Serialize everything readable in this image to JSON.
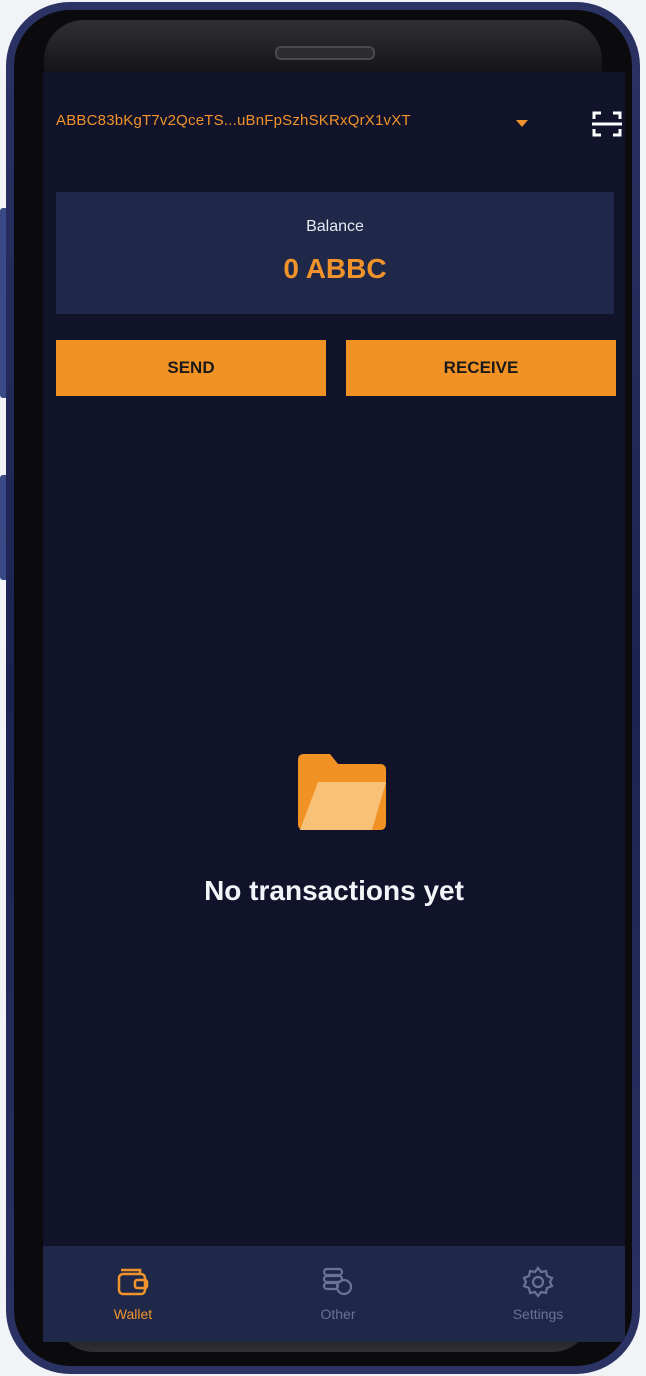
{
  "header": {
    "address": "ABBC83bKgT7v2QceTS...uBnFpSzhSKRxQrX1vXT",
    "dropdown_icon": "caret-down-icon",
    "scan_icon": "scan-icon"
  },
  "balance": {
    "label": "Balance",
    "value": "0 ABBC"
  },
  "actions": {
    "send_label": "SEND",
    "receive_label": "RECEIVE"
  },
  "empty_state": {
    "icon": "folder-icon",
    "message": "No transactions yet"
  },
  "tabs": [
    {
      "label": "Wallet",
      "icon": "wallet-icon",
      "active": true
    },
    {
      "label": "Other",
      "icon": "coins-icon",
      "active": false
    },
    {
      "label": "Settings",
      "icon": "gear-icon",
      "active": false
    }
  ],
  "colors": {
    "accent": "#f0932a",
    "background": "#11132b",
    "card": "#1f2849",
    "inactive_tab": "#6b7394"
  }
}
